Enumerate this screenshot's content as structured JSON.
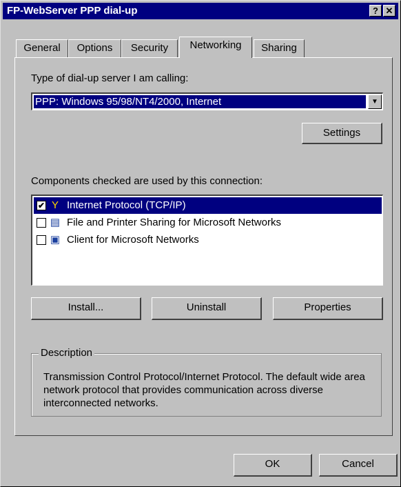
{
  "window": {
    "title": "FP-WebServer PPP dial-up",
    "help_label": "?",
    "close_label": "✕"
  },
  "tabs": [
    {
      "label": "General"
    },
    {
      "label": "Options"
    },
    {
      "label": "Security"
    },
    {
      "label": "Networking",
      "active": true
    },
    {
      "label": "Sharing"
    }
  ],
  "server_type": {
    "label": "Type of dial-up server I am calling:",
    "selected": "PPP: Windows 95/98/NT4/2000, Internet"
  },
  "settings_button": "Settings",
  "components": {
    "label": "Components checked are used by this connection:",
    "items": [
      {
        "label": "Internet Protocol (TCP/IP)",
        "checked": true,
        "selected": true,
        "icon": "network-protocol-icon"
      },
      {
        "label": "File and Printer Sharing for Microsoft Networks",
        "checked": false,
        "selected": false,
        "icon": "file-printer-sharing-icon"
      },
      {
        "label": "Client for Microsoft Networks",
        "checked": false,
        "selected": false,
        "icon": "network-client-icon"
      }
    ]
  },
  "buttons": {
    "install": "Install...",
    "uninstall": "Uninstall",
    "properties": "Properties",
    "ok": "OK",
    "cancel": "Cancel"
  },
  "description": {
    "legend": "Description",
    "text": "Transmission Control Protocol/Internet Protocol. The default wide area network protocol that provides communication across diverse interconnected networks."
  }
}
